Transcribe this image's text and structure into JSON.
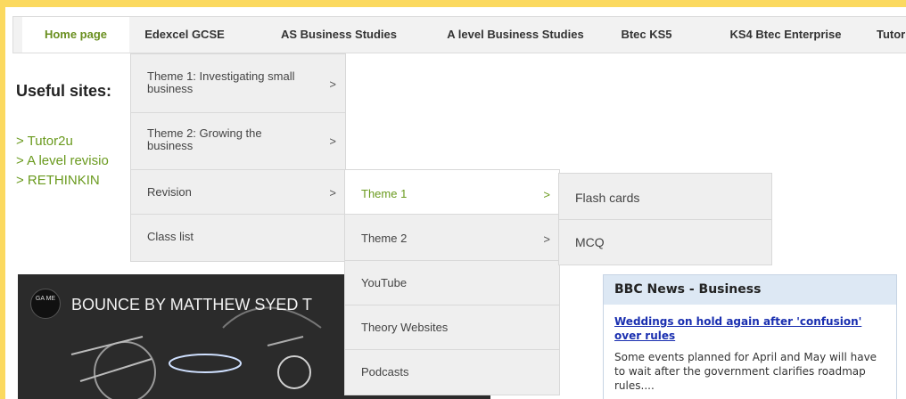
{
  "nav": {
    "tabs": [
      {
        "label": "Home page"
      },
      {
        "label": "Edexcel GCSE"
      },
      {
        "label": "AS Business Studies"
      },
      {
        "label": "A level Business Studies"
      },
      {
        "label": "Btec KS5"
      },
      {
        "label": "KS4 Btec Enterprise"
      },
      {
        "label": "Tutor"
      }
    ]
  },
  "content": {
    "title": "Useful sites:",
    "links": [
      "> Tutor2u",
      "> A level revisio",
      ">  RETHINKIN"
    ]
  },
  "menu1": {
    "items": [
      {
        "label": "Theme 1: Investigating small business",
        "arrow": ">"
      },
      {
        "label": "Theme 2: Growing the business",
        "arrow": ">"
      },
      {
        "label": "Revision",
        "arrow": ">"
      },
      {
        "label": "Class list",
        "arrow": ""
      }
    ]
  },
  "menu2": {
    "items": [
      {
        "label": "Theme 1",
        "arrow": ">"
      },
      {
        "label": "Theme 2",
        "arrow": ">"
      },
      {
        "label": "YouTube",
        "arrow": ""
      },
      {
        "label": "Theory Websites",
        "arrow": ""
      },
      {
        "label": "Podcasts",
        "arrow": ""
      }
    ]
  },
  "menu3": {
    "items": [
      {
        "label": "Flash cards"
      },
      {
        "label": "MCQ"
      }
    ]
  },
  "video": {
    "logo": "GA ME",
    "title": "BOUNCE BY MATTHEW SYED T"
  },
  "bbc": {
    "title": "BBC News - Business",
    "headline": "Weddings on hold again after 'confusion' over rules",
    "summary": "Some events planned for April and May will have to wait after the government clarifies roadmap rules...."
  },
  "colors": {
    "border": "#fbd95f",
    "active_text": "#6a8f1f",
    "link": "#6a9a1e",
    "headline": "#1a2fb0"
  }
}
